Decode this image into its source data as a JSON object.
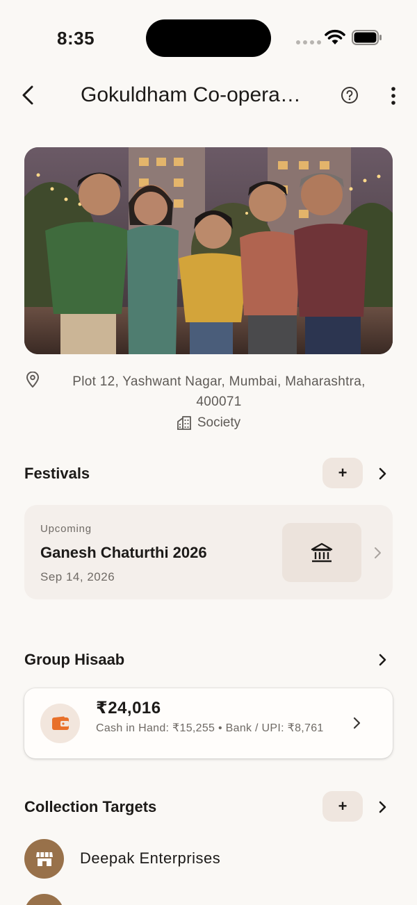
{
  "status_bar": {
    "time": "8:35"
  },
  "nav": {
    "title": "Gokuldham Co-opera…"
  },
  "location": {
    "address": "Plot 12, Yashwant Nagar, Mumbai, Maharashtra, 400071",
    "type": "Society"
  },
  "festivals": {
    "title": "Festivals",
    "add_label": "+",
    "card": {
      "eyebrow": "Upcoming",
      "name": "Ganesh Chaturthi 2026",
      "date": "Sep 14, 2026",
      "icon": "temple-icon"
    }
  },
  "hisaab": {
    "title": "Group Hisaab",
    "total": "₹24,016",
    "detail": "Cash in Hand: ₹15,255 • Bank / UPI: ₹8,761",
    "icon": "wallet-icon",
    "accent": "#e8702a"
  },
  "collection": {
    "title": "Collection Targets",
    "add_label": "+",
    "items": [
      {
        "name": "Deepak Enterprises",
        "icon": "store-icon"
      },
      {
        "name": "",
        "icon": "store-icon"
      }
    ]
  },
  "colors": {
    "background": "#faf8f5",
    "card": "#f4efeb",
    "chip": "#efe6df",
    "avatar": "#98714a"
  }
}
